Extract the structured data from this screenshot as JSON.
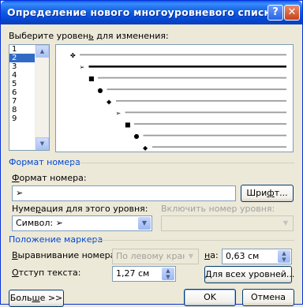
{
  "window": {
    "title": "Определение нового многоуровневого списка"
  },
  "title_buttons": {
    "help": "?",
    "close": "✕"
  },
  "level_select": {
    "label_pre": "Выберите уровен",
    "label_key": "ь",
    "label_post": " для изменения:",
    "levels": [
      "1",
      "2",
      "3",
      "4",
      "5",
      "6",
      "7",
      "8",
      "9"
    ],
    "selected": "2"
  },
  "number_format": {
    "group_title": "Формат номера",
    "format_label_key": "Ф",
    "format_label_rest": "ормат номера:",
    "format_value": "➢",
    "font_button_pre": "Шри",
    "font_button_key": "ф",
    "font_button_post": "т...",
    "numbering_label_pre": "Нуме",
    "numbering_label_key": "р",
    "numbering_label_post": "ация для этого уровня:",
    "numbering_value": "Символ: ➢",
    "include_label": "Включить номер уровня:",
    "include_value": ""
  },
  "marker_position": {
    "group_title": "Положение маркера",
    "alignment_label_key": "В",
    "alignment_label_rest": "ыравнивание номера:",
    "alignment_value": "По левому краю",
    "at_label_key": "н",
    "at_label_rest": "а:",
    "at_value": "0,63 см",
    "indent_label_key": "О",
    "indent_label_rest": "тступ текста:",
    "indent_value": "1,27 см",
    "all_levels_key": "Д",
    "all_levels_rest": "ля всех уровней..."
  },
  "footer": {
    "more_pre": "Боль",
    "more_key": "ш",
    "more_post": "е >>",
    "ok": "OK",
    "cancel": "Отмена"
  },
  "preview": {
    "bullets": [
      "✤",
      "➢",
      "■",
      "●",
      "◆",
      "➢",
      "■",
      "●",
      "◆"
    ]
  },
  "colors": {
    "title_bar": "#0a5ae8",
    "group_title": "#0046d5",
    "selection": "#316ac5"
  }
}
